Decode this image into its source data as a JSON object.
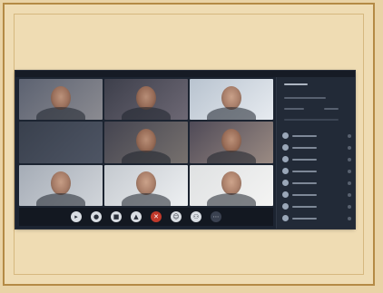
{
  "meeting": {
    "participant_count": 9,
    "panel_participant_rows": 8
  },
  "toolbar": {
    "buttons": [
      {
        "icon": "chat-icon",
        "glyph": "▸"
      },
      {
        "icon": "microphone-icon",
        "glyph": "●"
      },
      {
        "icon": "video-icon",
        "glyph": "■"
      },
      {
        "icon": "share-screen-icon",
        "glyph": "▲"
      },
      {
        "icon": "end-call-icon",
        "glyph": "✕"
      },
      {
        "icon": "reactions-icon",
        "glyph": "☺"
      },
      {
        "icon": "participants-icon",
        "glyph": "⚇"
      },
      {
        "icon": "more-icon",
        "glyph": "⋯"
      }
    ]
  },
  "colors": {
    "background": "#e9d3a6",
    "frame": "#b48a45",
    "screen": "#1c2431",
    "end_call": "#c0392b"
  }
}
